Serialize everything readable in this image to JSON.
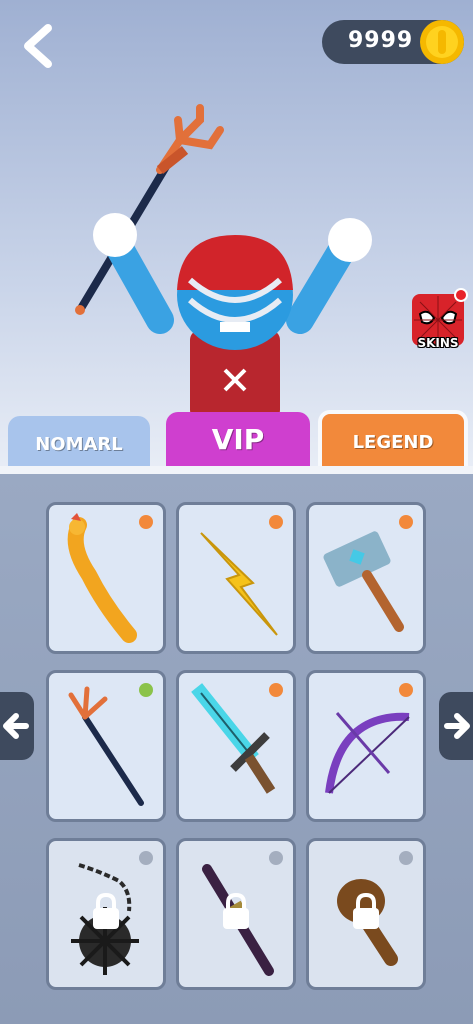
{
  "header": {
    "coins": "9999",
    "skins_label": "SKINS"
  },
  "tabs": [
    {
      "label": "NOMARL",
      "color": "#a8c4ec"
    },
    {
      "label": "VIP",
      "color": "#cf3fcf",
      "selected": true
    },
    {
      "label": "LEGEND",
      "color": "#f2893b"
    }
  ],
  "items": [
    {
      "name": "rubber-chicken",
      "status_color": "#f2893b",
      "locked": false
    },
    {
      "name": "lightning-bolt",
      "status_color": "#f2893b",
      "locked": false
    },
    {
      "name": "stone-hammer",
      "status_color": "#f2893b",
      "locked": false
    },
    {
      "name": "trident",
      "status_color": "#8bc34a",
      "locked": false,
      "equipped": true
    },
    {
      "name": "pixel-diamond-sword",
      "status_color": "#f2893b",
      "locked": false
    },
    {
      "name": "purple-bow",
      "status_color": "#f2893b",
      "locked": false
    },
    {
      "name": "spiked-mace",
      "status_color": "#a4aebf",
      "locked": true
    },
    {
      "name": "scepter",
      "status_color": "#a4aebf",
      "locked": true
    },
    {
      "name": "wooden-club",
      "status_color": "#a4aebf",
      "locked": true
    }
  ]
}
